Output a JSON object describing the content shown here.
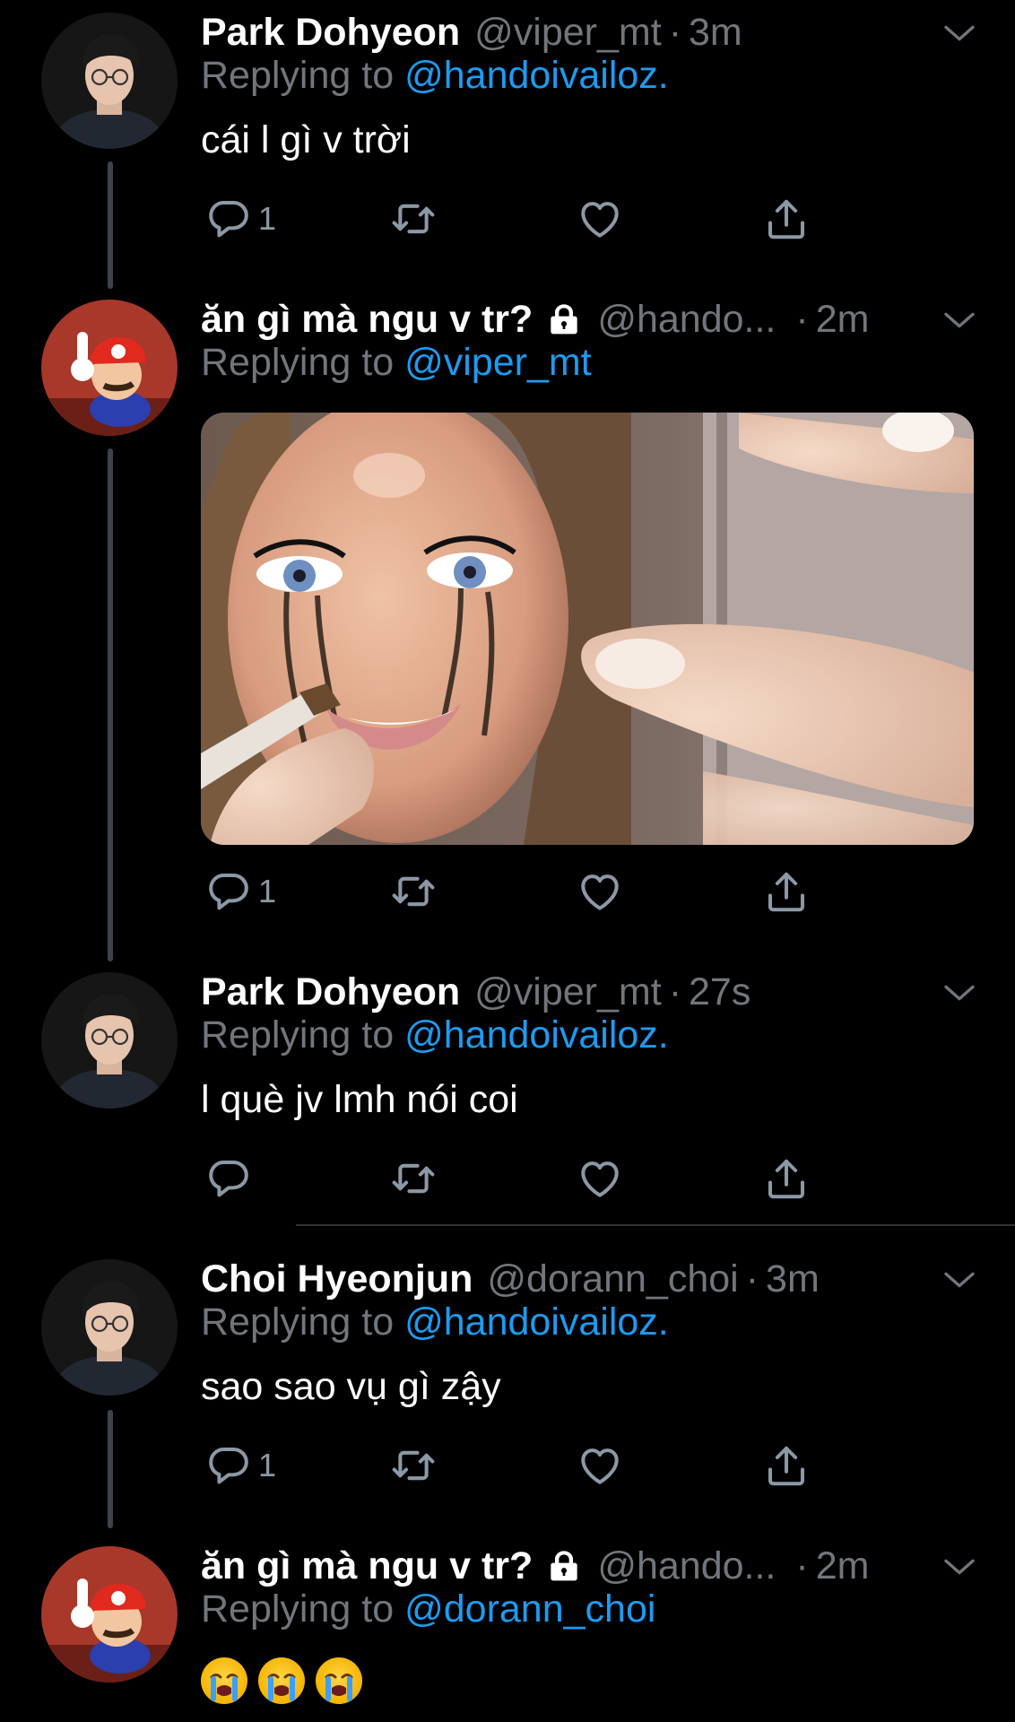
{
  "tweets": [
    {
      "name": "Park Dohyeon",
      "handle": "@viper_mt",
      "dot": "·",
      "time": "3m",
      "replying_prefix": "Replying to",
      "replying_to": "@handoivailoz.",
      "text": "cái l gì v trời",
      "reply_count": "1",
      "avatar_icon": "profile-photo"
    },
    {
      "name": "ăn gì mà ngu v tr?",
      "handle": "@hando...",
      "dot": "·",
      "time": "2m",
      "locked": true,
      "replying_prefix": "Replying to",
      "replying_to": "@viper_mt",
      "reply_count": "1",
      "media": "doll-photo",
      "avatar_icon": "mario-avatar"
    },
    {
      "name": "Park Dohyeon",
      "handle": "@viper_mt",
      "dot": "·",
      "time": "27s",
      "replying_prefix": "Replying to",
      "replying_to": "@handoivailoz.",
      "text": "l què jv lmh nói coi",
      "avatar_icon": "profile-photo"
    },
    {
      "name": "Choi Hyeonjun",
      "handle": "@dorann_choi",
      "dot": "·",
      "time": "3m",
      "replying_prefix": "Replying to",
      "replying_to": "@handoivailoz.",
      "text": "sao sao vụ gì zậy",
      "reply_count": "1",
      "avatar_icon": "profile-photo"
    },
    {
      "name": "ăn gì mà ngu v tr?",
      "handle": "@hando...",
      "dot": "·",
      "time": "2m",
      "locked": true,
      "replying_prefix": "Replying to",
      "replying_to": "@dorann_choi",
      "emojis": [
        "loudly-crying-face",
        "loudly-crying-face",
        "loudly-crying-face"
      ],
      "avatar_icon": "mario-avatar"
    }
  ],
  "colors": {
    "background": "#000000",
    "text": "#ffffff",
    "secondary": "#71767b",
    "link": "#1d9bf0",
    "thread_line": "#3d4349"
  }
}
